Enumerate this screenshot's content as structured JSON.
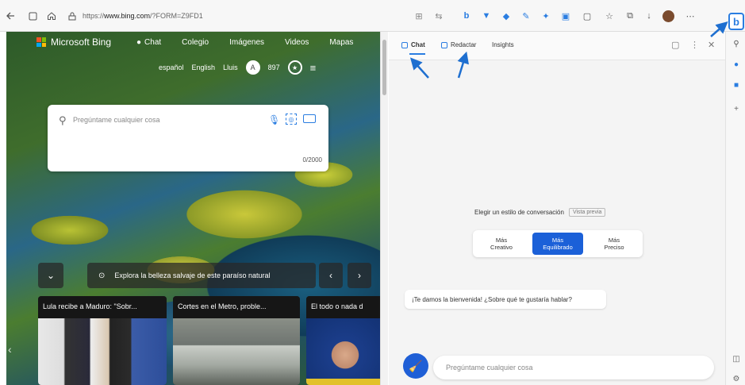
{
  "browser": {
    "url_prefix": "https://",
    "url_domain": "www.bing.com",
    "url_rest": "/?FORM=Z9FD1",
    "bing_button": "b"
  },
  "bing": {
    "brand": "Microsoft Bing",
    "nav": [
      "Chat",
      "Colegio",
      "Imágenes",
      "Videos",
      "Mapas"
    ],
    "lang_es": "español",
    "lang_en": "English",
    "user": "Lluis",
    "avatar_initial": "A",
    "points": "897",
    "search_placeholder": "Pregúntame cualquier cosa",
    "char_counter": "0/2000",
    "banner_text": "Explora la belleza salvaje de este paraíso natural",
    "news": [
      "Lula recibe a Maduro: \"Sobr...",
      "Cortes en el Metro, proble...",
      "El todo o nada d"
    ]
  },
  "panel": {
    "tabs": [
      "Chat",
      "Redactar",
      "Insights"
    ],
    "style_prompt": "Elegir un estilo de conversación",
    "preview_tag": "Vista previa",
    "styles": [
      {
        "line1": "Más",
        "line2": "Creativo"
      },
      {
        "line1": "Más",
        "line2": "Equilibrado"
      },
      {
        "line1": "Más",
        "line2": "Preciso"
      }
    ],
    "welcome": "¡Te damos la bienvenida! ¿Sobre qué te gustaría hablar?",
    "input_placeholder": "Pregúntame cualquier cosa"
  },
  "colors": {
    "accent": "#2a7de1",
    "selected_style": "#1b60d8",
    "broom": "#1f5fd6"
  }
}
